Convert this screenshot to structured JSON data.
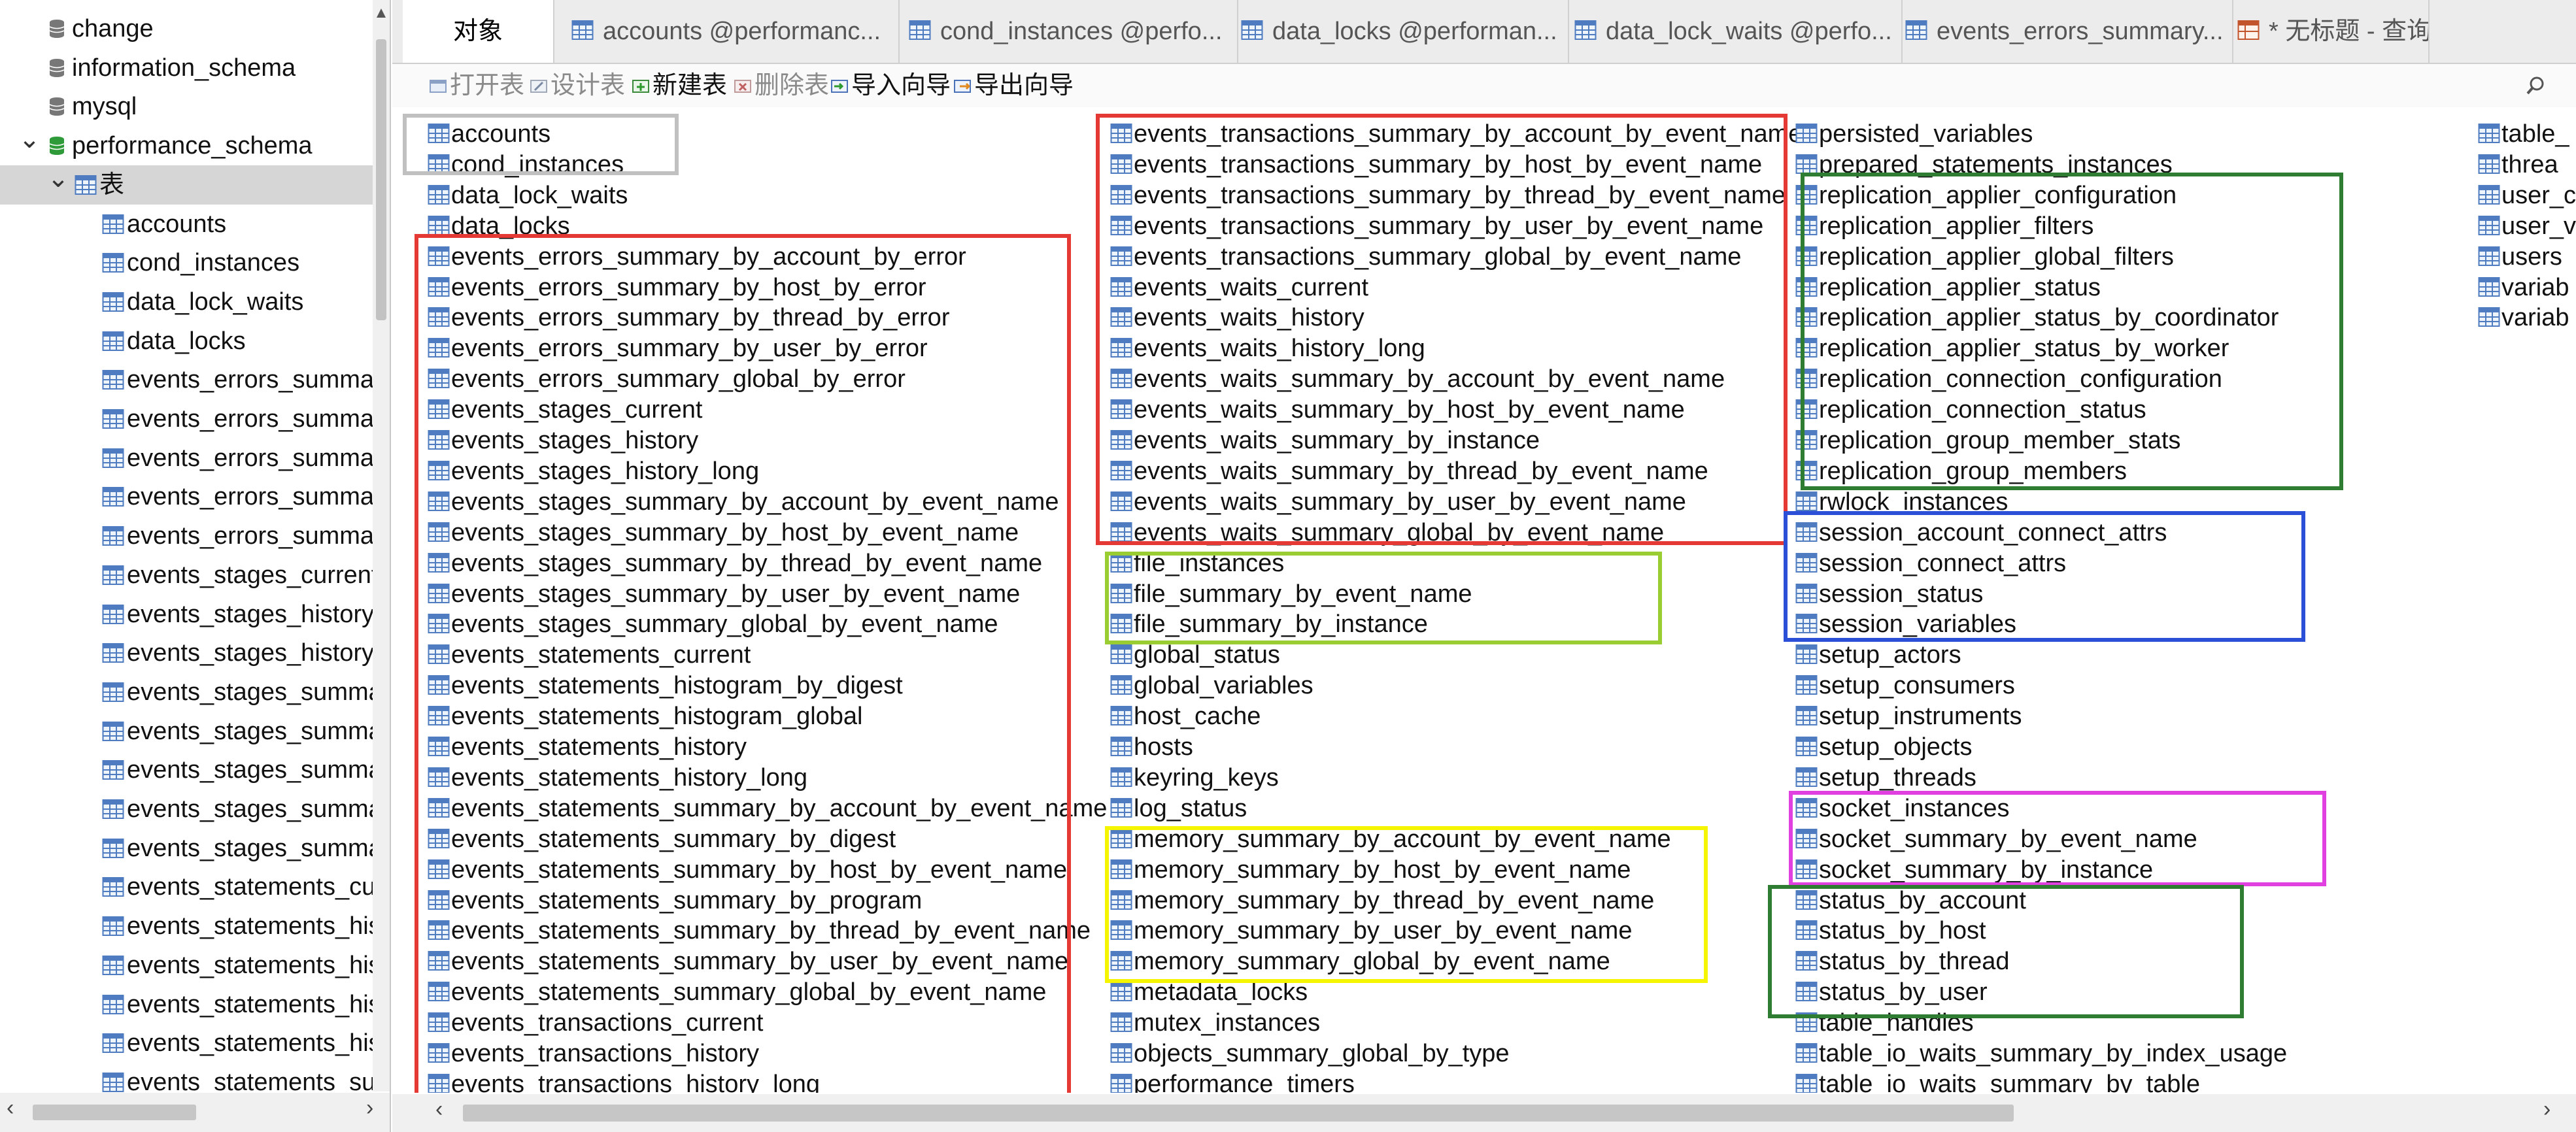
{
  "navigator": {
    "databases": [
      {
        "name": "change"
      },
      {
        "name": "information_schema"
      },
      {
        "name": "mysql"
      },
      {
        "name": "performance_schema"
      }
    ],
    "tables_group": "表",
    "tables": [
      "accounts",
      "cond_instances",
      "data_lock_waits",
      "data_locks",
      "events_errors_summary",
      "events_errors_summary",
      "events_errors_summary",
      "events_errors_summary",
      "events_errors_summary",
      "events_stages_current",
      "events_stages_history",
      "events_stages_history_l",
      "events_stages_summary",
      "events_stages_summary",
      "events_stages_summary",
      "events_stages_summary",
      "events_stages_summary",
      "events_statements_curr",
      "events_statements_histo",
      "events_statements_histo",
      "events_statements_histo",
      "events_statements_histo",
      "events_statements_sum"
    ]
  },
  "tabs": [
    {
      "label": "对象",
      "active": true,
      "icon": ""
    },
    {
      "label": "accounts @performanc...",
      "icon": "table-icon"
    },
    {
      "label": "cond_instances @perfo...",
      "icon": "table-icon"
    },
    {
      "label": "data_locks @performan...",
      "icon": "table-icon"
    },
    {
      "label": "data_lock_waits @perfo...",
      "icon": "table-icon"
    },
    {
      "label": "events_errors_summary...",
      "icon": "table-icon"
    },
    {
      "label": "* 无标题 - 查询",
      "icon": "query-icon"
    }
  ],
  "toolbar": {
    "open": "打开表",
    "design": "设计表",
    "new": "新建表",
    "delete": "删除表",
    "import": "导入向导",
    "export": "导出向导"
  },
  "objects": {
    "col1": [
      "accounts",
      "cond_instances",
      "data_lock_waits",
      "data_locks",
      "events_errors_summary_by_account_by_error",
      "events_errors_summary_by_host_by_error",
      "events_errors_summary_by_thread_by_error",
      "events_errors_summary_by_user_by_error",
      "events_errors_summary_global_by_error",
      "events_stages_current",
      "events_stages_history",
      "events_stages_history_long",
      "events_stages_summary_by_account_by_event_name",
      "events_stages_summary_by_host_by_event_name",
      "events_stages_summary_by_thread_by_event_name",
      "events_stages_summary_by_user_by_event_name",
      "events_stages_summary_global_by_event_name",
      "events_statements_current",
      "events_statements_histogram_by_digest",
      "events_statements_histogram_global",
      "events_statements_history",
      "events_statements_history_long",
      "events_statements_summary_by_account_by_event_name",
      "events_statements_summary_by_digest",
      "events_statements_summary_by_host_by_event_name",
      "events_statements_summary_by_program",
      "events_statements_summary_by_thread_by_event_name",
      "events_statements_summary_by_user_by_event_name",
      "events_statements_summary_global_by_event_name",
      "events_transactions_current",
      "events_transactions_history",
      "events_transactions_history_long"
    ],
    "col2": [
      "events_transactions_summary_by_account_by_event_name",
      "events_transactions_summary_by_host_by_event_name",
      "events_transactions_summary_by_thread_by_event_name",
      "events_transactions_summary_by_user_by_event_name",
      "events_transactions_summary_global_by_event_name",
      "events_waits_current",
      "events_waits_history",
      "events_waits_history_long",
      "events_waits_summary_by_account_by_event_name",
      "events_waits_summary_by_host_by_event_name",
      "events_waits_summary_by_instance",
      "events_waits_summary_by_thread_by_event_name",
      "events_waits_summary_by_user_by_event_name",
      "events_waits_summary_global_by_event_name",
      "file_instances",
      "file_summary_by_event_name",
      "file_summary_by_instance",
      "global_status",
      "global_variables",
      "host_cache",
      "hosts",
      "keyring_keys",
      "log_status",
      "memory_summary_by_account_by_event_name",
      "memory_summary_by_host_by_event_name",
      "memory_summary_by_thread_by_event_name",
      "memory_summary_by_user_by_event_name",
      "memory_summary_global_by_event_name",
      "metadata_locks",
      "mutex_instances",
      "objects_summary_global_by_type",
      "performance_timers"
    ],
    "col3": [
      "persisted_variables",
      "prepared_statements_instances",
      "replication_applier_configuration",
      "replication_applier_filters",
      "replication_applier_global_filters",
      "replication_applier_status",
      "replication_applier_status_by_coordinator",
      "replication_applier_status_by_worker",
      "replication_connection_configuration",
      "replication_connection_status",
      "replication_group_member_stats",
      "replication_group_members",
      "rwlock_instances",
      "session_account_connect_attrs",
      "session_connect_attrs",
      "session_status",
      "session_variables",
      "setup_actors",
      "setup_consumers",
      "setup_instruments",
      "setup_objects",
      "setup_threads",
      "socket_instances",
      "socket_summary_by_event_name",
      "socket_summary_by_instance",
      "status_by_account",
      "status_by_host",
      "status_by_thread",
      "status_by_user",
      "table_handles",
      "table_io_waits_summary_by_index_usage",
      "table_io_waits_summary_by_table"
    ],
    "col4": [
      "table_",
      "threa",
      "user_c",
      "user_v",
      "users",
      "variab",
      "variab"
    ]
  },
  "highlight_colors": {
    "gray": "#c0c0c0",
    "red": "#e53935",
    "lime": "#9acd32",
    "yellow": "#f5f500",
    "green": "#2e7d32",
    "blue": "#2b4fd6",
    "magenta": "#e040e0"
  }
}
